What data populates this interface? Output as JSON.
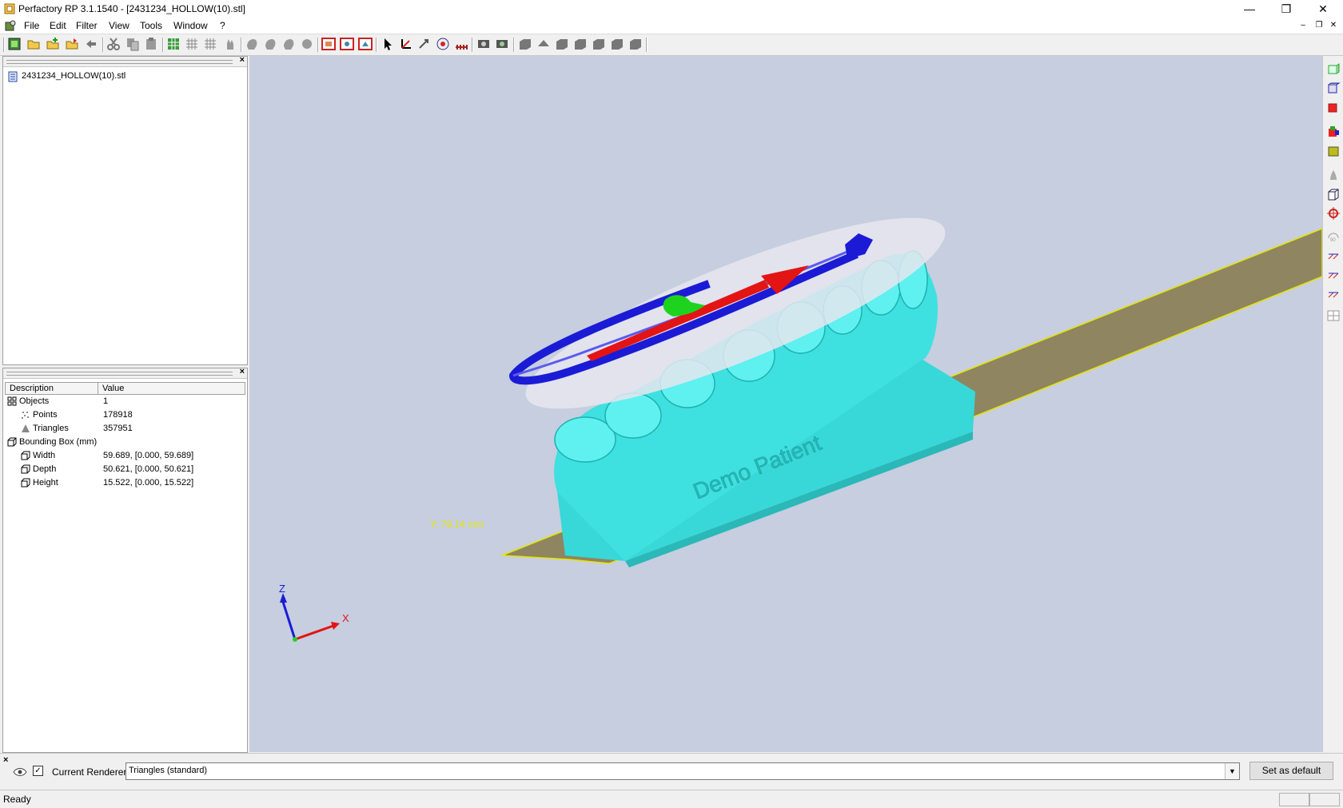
{
  "window": {
    "title": "Perfactory RP 3.1.1540 - [2431234_HOLLOW(10).stl]",
    "minimize": "—",
    "restore": "❐",
    "close": "✕"
  },
  "menu": {
    "items": [
      "File",
      "Edit",
      "Filter",
      "View",
      "Tools",
      "Window",
      "?"
    ],
    "mdi_min": "–",
    "mdi_restore": "❐",
    "mdi_close": "✕"
  },
  "tree": {
    "close": "×",
    "item": "2431234_HOLLOW(10).stl"
  },
  "props": {
    "close": "×",
    "col_description": "Description",
    "col_value": "Value",
    "rows": [
      {
        "desc": "Objects",
        "value": "1"
      },
      {
        "desc": "Points",
        "value": "178918"
      },
      {
        "desc": "Triangles",
        "value": "357951"
      },
      {
        "desc": "Bounding Box (mm)",
        "value": ""
      },
      {
        "desc": "Width",
        "value": "59.689, [0.000, 59.689]"
      },
      {
        "desc": "Depth",
        "value": "50.621, [0.000, 50.621]"
      },
      {
        "desc": "Height",
        "value": "15.522, [0.000, 15.522]"
      }
    ]
  },
  "viewport": {
    "measure_label": "Y: 79.14 mm",
    "model_text": "Demo Patient",
    "axis_z": "Z",
    "axis_x": "X"
  },
  "renderer": {
    "close": "×",
    "label": "Current Renderer:",
    "value": "Triangles (standard)",
    "checked": "✓",
    "default_button": "Set as default"
  },
  "status": {
    "text": "Ready"
  },
  "colors": {
    "viewport_bg": "#c6cee0",
    "model": "#3fe0e0",
    "platform": "#8f8561",
    "ring_blue": "#1b1bd6",
    "arrow_red": "#e31414",
    "handle_green": "#1ed31e"
  }
}
